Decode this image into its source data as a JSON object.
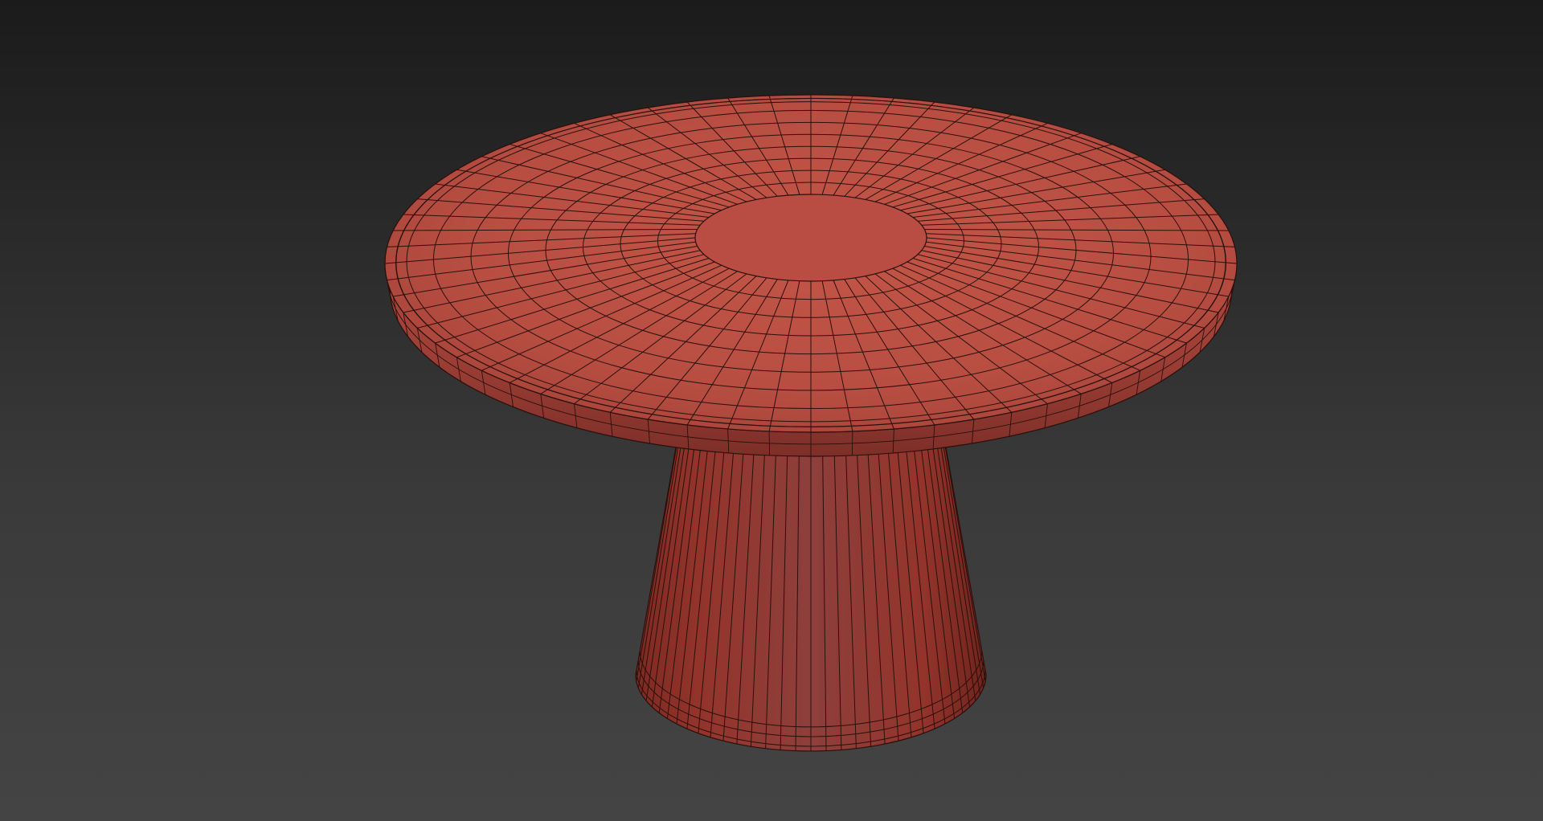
{
  "viewport": {
    "background_top": "#1b1b1b",
    "background_bottom": "#444444"
  },
  "model": {
    "object": "table",
    "display_mode": "shaded-with-wireframe",
    "material_color": "#b24a3f",
    "edge_color": "#2a0f0c",
    "tabletop": {
      "radial_segments": 64,
      "rings": 8
    },
    "pedestal": {
      "vertical_segments": 36,
      "bottom_rings": 3
    }
  }
}
